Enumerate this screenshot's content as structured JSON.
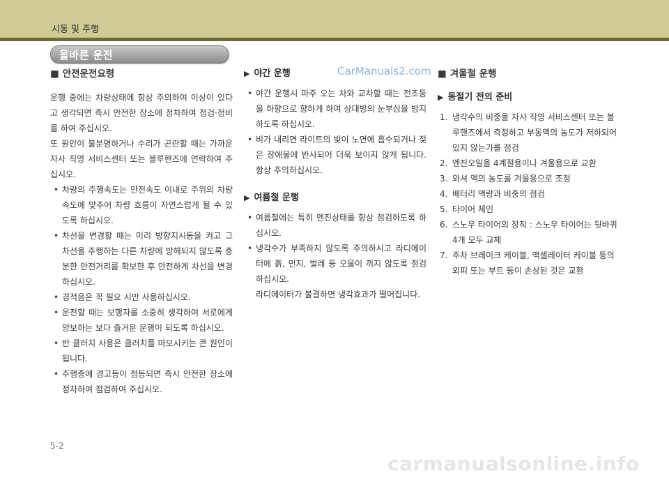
{
  "header": {
    "title": "시동 및 주행"
  },
  "section_title": "올바른 운전",
  "watermark": "CarManuals2.com",
  "col1": {
    "heading": "안전운전요령",
    "para1": "운행 중에는 차량상태에 항상 주의하여 이상이 있다고 생각되면 즉시 안전한 장소에 정차하여 점검·정비를 하여 주십시오.",
    "para2": "또 원인이 불분명하거나 수리가 곤란할 때는 가까운 자사 직영 서비스센터 또는 블루핸즈에 연락하여 주십시오.",
    "bullets": [
      "차량의 주행속도는 안전속도 이내로 주위의 차량 속도에 맞추어 차량 흐름이 자연스럽게 될 수 있도록 하십시오.",
      "차선을 변경할 때는 미리 방향지시등을 켜고 그 차선을 주행하는 다른 차량에 방해되지 않도록 충분한 안전거리를 확보한 후 안전하게 차선을 변경하십시오.",
      "경적음은 꼭 필요 시만 사용하십시오.",
      "운전할 때는 보행자를 소중히 생각하여 서로에게 양보하는 보다 즐거운 운행이 되도록 하십시오.",
      "반 클러치 사용은 클러치를 마모시키는 큰 원인이 됩니다.",
      "주행중에 경고등이 점등되면 즉시 안전한 장소에 정차하여 점검하여 주십시오."
    ]
  },
  "col2": {
    "night": {
      "heading": "야간 운행",
      "bullets": [
        "야간 운행시 마주 오는 차와 교차할 때는 전조등을 하향으로 향하게 하여 상대방의 눈부심을 방지하도록 하십시오.",
        "비가 내리면 라이트의 빛이 노면에 흡수되거나 젖은 장애물에 반사되어 더욱 보이지 않게 됩니다. 항상 주의하십시오."
      ]
    },
    "summer": {
      "heading": "여름철 운행",
      "bullets": [
        "여름철에는 특히 엔진상태를 항상 점검하도록 하십시오.",
        "냉각수가 부족하지 않도록 주의하시고 라디에이터에 흙, 먼지, 벌레 등 오물이 끼지 않도록 점검하십시오.",
        "라디에이터가 불결하면 냉각효과가 떨어집니다."
      ]
    }
  },
  "col3": {
    "heading": "겨울철 운행",
    "subheading": "동절기 전의 준비",
    "items": [
      {
        "n": "1.",
        "text": "냉각수의 비중을 자사 직영 서비스센터 또는 블루핸즈에서 측정하고 부동액의 농도가 저하되어 있지 않는가를 점검"
      },
      {
        "n": "2.",
        "text": "엔진오일을 4계절용이나 겨울용으로 교환"
      },
      {
        "n": "3.",
        "text": "와셔 액의 농도를 겨울용으로 조정"
      },
      {
        "n": "4.",
        "text": "배터리 액량과 비중의 점검"
      },
      {
        "n": "5.",
        "text": "타이어 체인"
      },
      {
        "n": "6.",
        "text": "스노우 타이어의 장착 : 스노우 타이어는 뒷바퀴 4개 모두 교체"
      },
      {
        "n": "7.",
        "text": "주차 브레이크 케이블, 액셀레이터 케이블 등의 외피 또는 부트 등이 손상된 것은 교환"
      }
    ]
  },
  "page_number": "5-2",
  "footer_site": "carmanualsonline.info"
}
